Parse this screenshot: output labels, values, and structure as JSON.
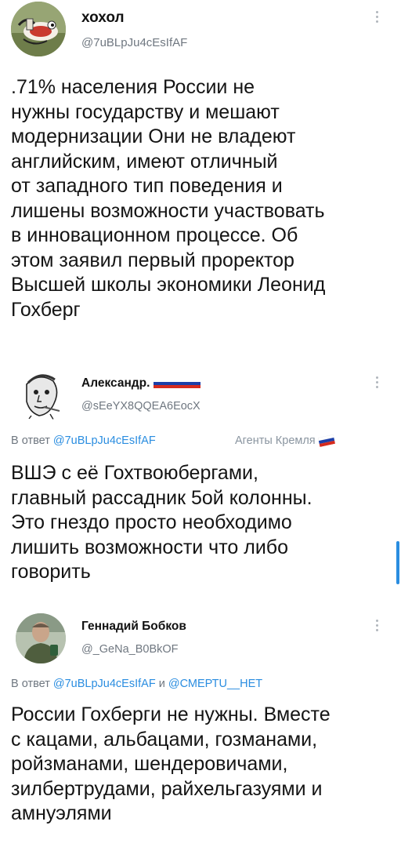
{
  "tweet1": {
    "name": "хохол",
    "handle": "@7uBLpJu4cEsIfAF",
    "lines": [
      ".71% населения России не",
      "нужны государству и мешают",
      "модернизации Они не владеют",
      "английским, имеют отличный",
      "от западного тип поведения и",
      "лишены возможности участвовать",
      "в инновационном процессе. Об",
      "этом заявил первый проректор",
      "Высшей школы экономики Леонид",
      "Гохберг"
    ]
  },
  "tweet2": {
    "name": "Александр.",
    "handle": "@sEeYX8QQEA6EocX",
    "reply_prefix": "В ответ",
    "reply_mention": "@7uBLpJu4cEsIfAF",
    "agents_label": "Агенты Кремля",
    "lines": [
      "ВШЭ с её Гохтвоюбергами,",
      "главный рассадник 5ой колонны.",
      "Это гнездо просто необходимо",
      "лишить возможности что либо",
      "говорить"
    ]
  },
  "tweet3": {
    "name": "Геннадий Бобков",
    "handle": "@_GeNa_B0BkOF",
    "reply_prefix": "В ответ",
    "reply_mention1": "@7uBLpJu4cEsIfAF",
    "reply_and": "и",
    "reply_mention2": "@СМЕРТU__НЕТ",
    "lines": [
      "России Гохберги не нужны. Вместе",
      "с кацами, альбацами, гозманами,",
      "ройзманами, шендеровичами,",
      "зилбертрудами, райхельгазуями и",
      "амнуэлями"
    ]
  },
  "colors": {
    "link": "#2a8de0",
    "muted": "#6f7780",
    "text": "#141414",
    "flag_white": "#ffffff",
    "flag_blue": "#1c3fa8",
    "flag_red": "#d52b1e"
  }
}
